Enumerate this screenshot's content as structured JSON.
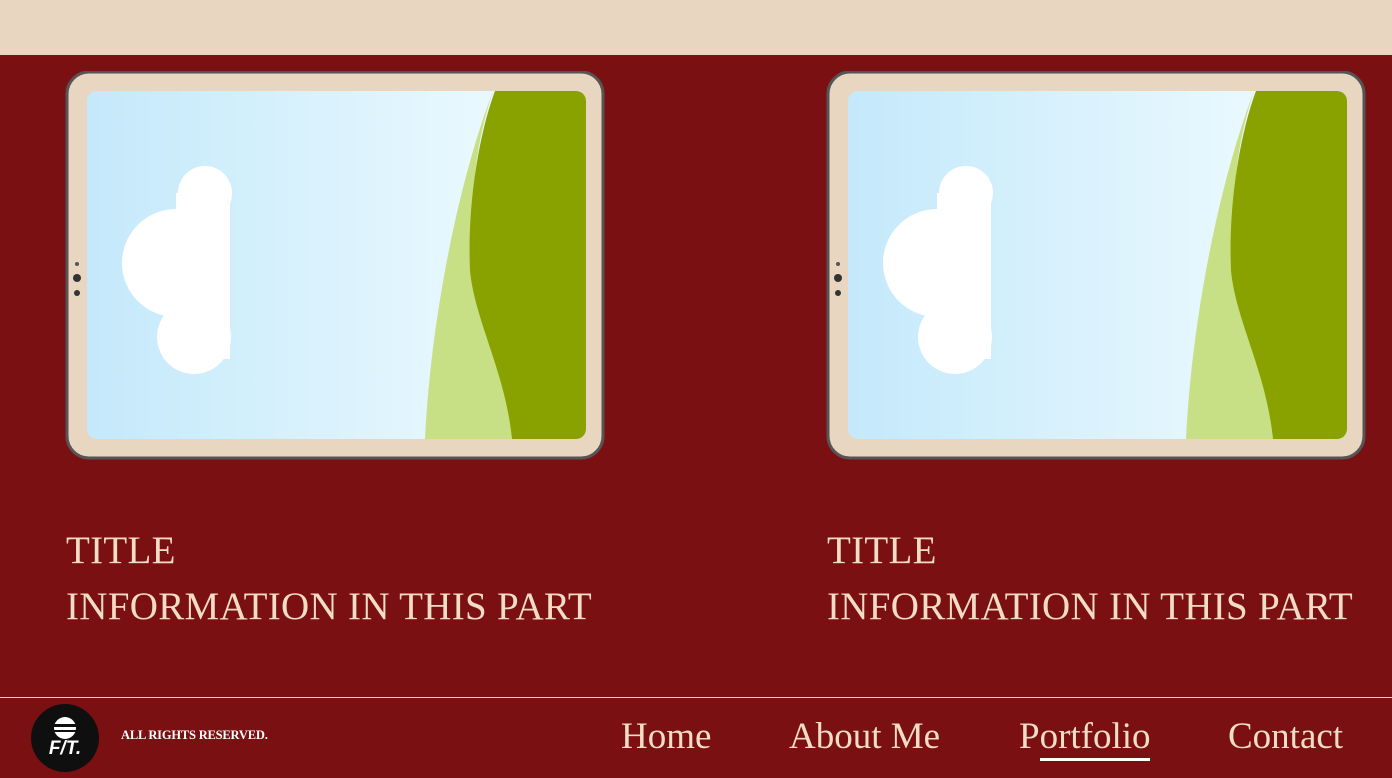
{
  "header": {},
  "portfolio": {
    "cards": [
      {
        "title": "TITLE",
        "info": "INFORMATION IN THIS PART"
      },
      {
        "title": "TITLE",
        "info": "INFORMATION IN THIS PART"
      }
    ]
  },
  "footer": {
    "logo_text": "F/T.",
    "copyright": "ALL RIGHTS RESERVED.",
    "nav": {
      "home": "Home",
      "about": "About Me",
      "portfolio": "Portfolio",
      "contact": "Contact",
      "active": "Portfolio"
    }
  },
  "colors": {
    "background": "#7b1012",
    "header_bar": "#e8d6c1",
    "text": "#f1dcc6",
    "tablet_frame": "#e8d6c1",
    "hill_dark": "#8aa200",
    "hill_light": "#c7e085",
    "sky": "#c4e9fb"
  }
}
